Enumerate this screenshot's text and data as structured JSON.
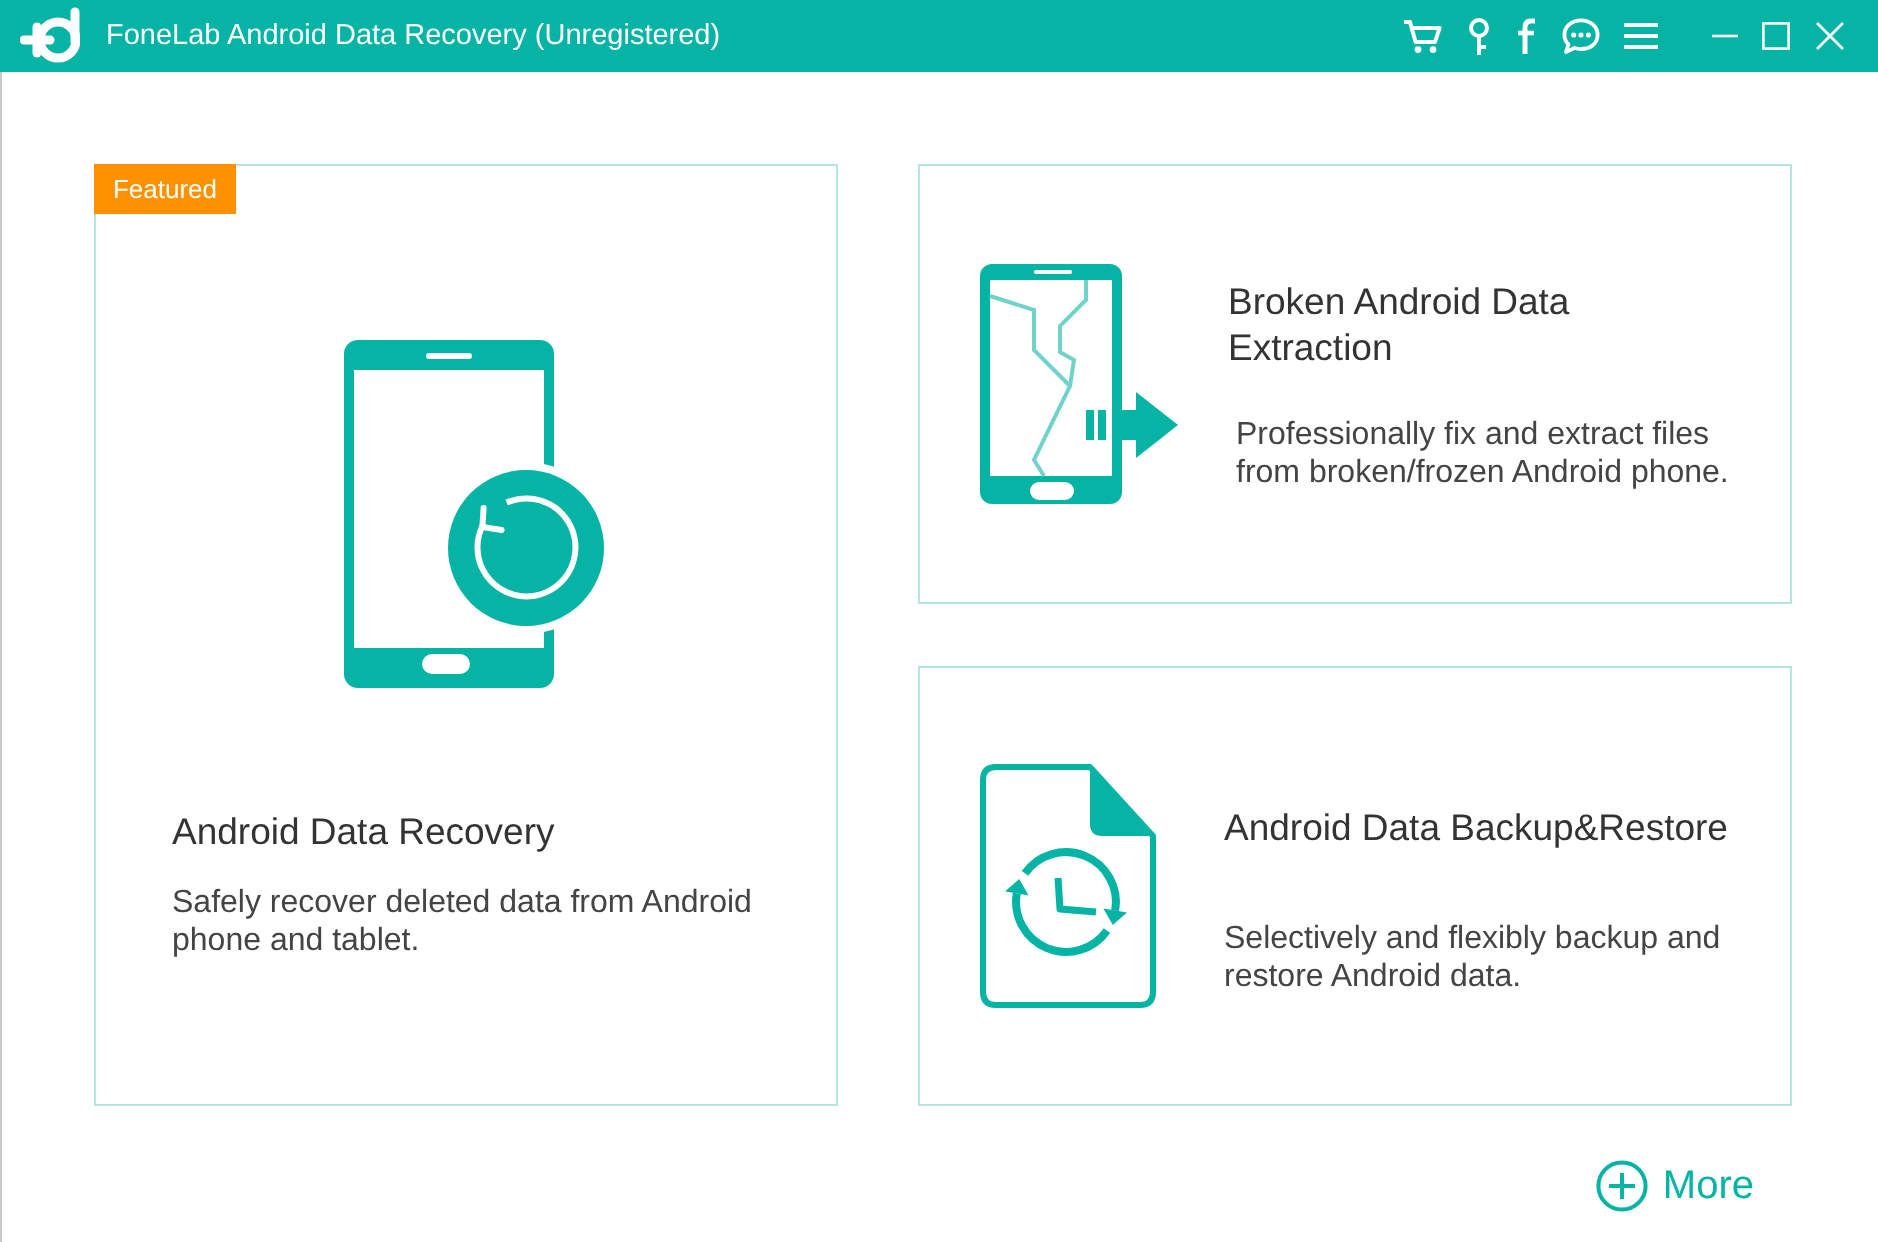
{
  "window": {
    "title": "FoneLab Android Data Recovery (Unregistered)"
  },
  "cards": [
    {
      "kind": "recovery",
      "badge": "Featured",
      "title": "Android Data Recovery",
      "description": "Safely recover deleted data from Android phone and tablet."
    },
    {
      "kind": "broken",
      "title": "Broken Android Data Extraction",
      "description": "Professionally fix and extract files from broken/frozen Android phone."
    },
    {
      "kind": "backup",
      "title": "Android Data Backup&Restore",
      "description": "Selectively and flexibly backup and restore Android data."
    }
  ],
  "more_button": {
    "label": "More"
  }
}
